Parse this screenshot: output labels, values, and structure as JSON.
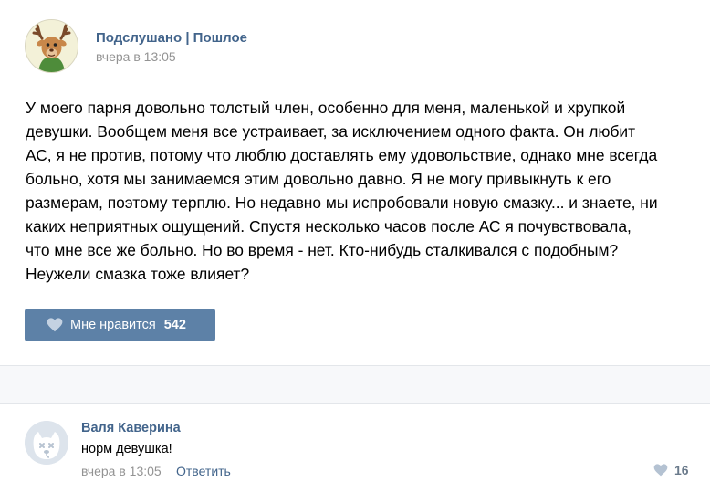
{
  "post": {
    "group_name": "Подслушано | Пошлое",
    "time": "вчера в 13:05",
    "avatar_icon": "deer-avatar-icon",
    "text_lines": [
      "У моего парня довольно толстый член, особенно для меня, маленькой и хрупкой",
      "девушки. Вообщем меня все устраивает, за исключением одного факта. Он любит",
      "АС, я не против, потому что люблю доставлять ему удовольствие, однако мне всегда",
      "больно, хотя мы занимаемся этим довольно давно. Я не могу привыкнуть к его",
      "размерам, поэтому терплю. Но недавно мы испробовали новую смазку... и знаете, ни",
      "каких неприятных ощущений. Спустя несколько часов после АС я почувствовала,",
      "что мне все же больно. Но во время - нет. Кто-нибудь сталкивался с подобным?",
      "Неужели смазка тоже влияет?"
    ],
    "like_button": {
      "label": "Мне нравится",
      "count": "542",
      "icon": "heart-icon",
      "color": "#5d81a7"
    }
  },
  "comment": {
    "author": "Валя Каверина",
    "text": "норм девушка!",
    "time": "вчера в 13:05",
    "reply_label": "Ответить",
    "like_count": "16",
    "avatar_icon": "default-dog-avatar-icon"
  },
  "colors": {
    "link": "#42648b",
    "meta": "#939393",
    "band": "#f7f8fa"
  }
}
